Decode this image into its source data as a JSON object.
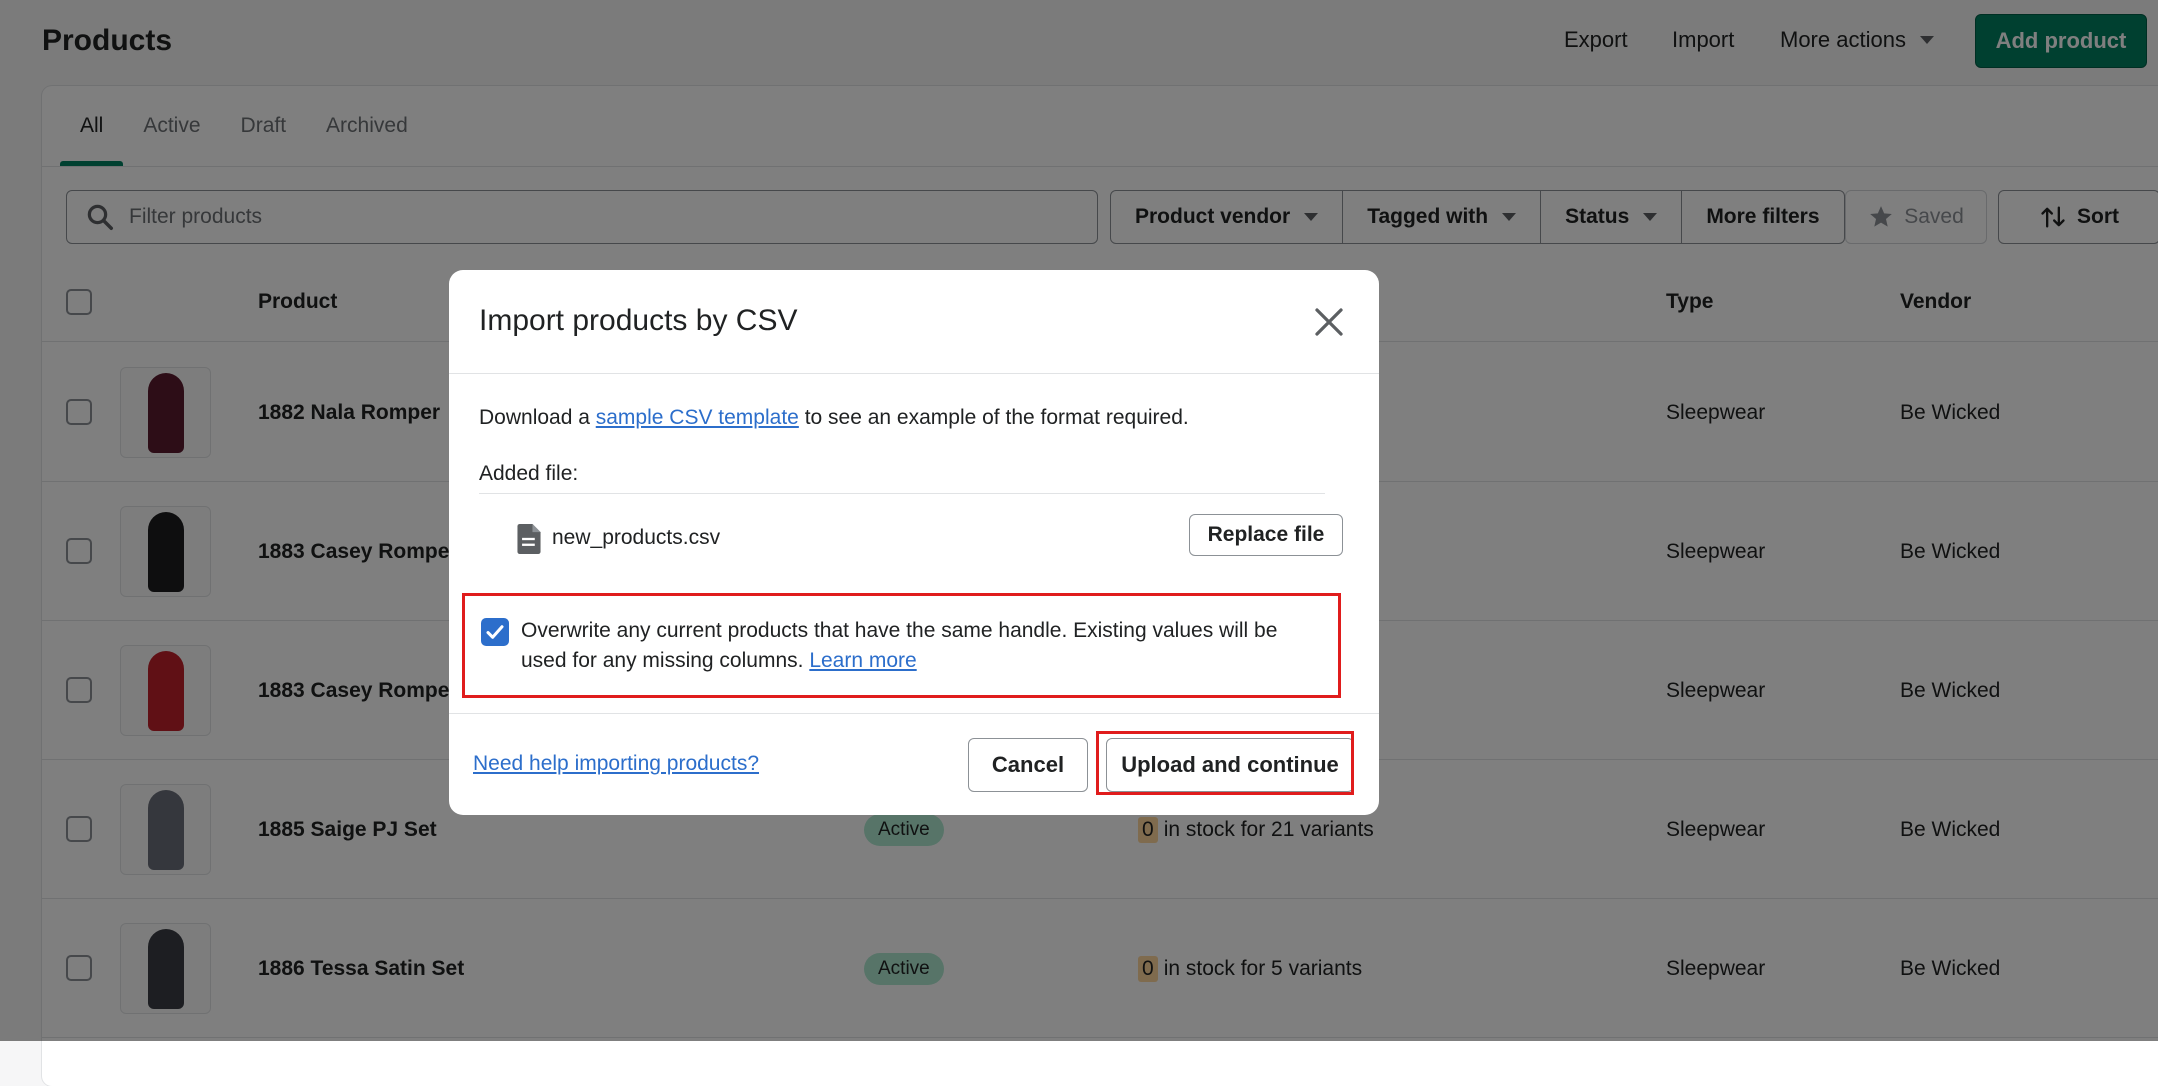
{
  "header": {
    "title": "Products",
    "export_label": "Export",
    "import_label": "Import",
    "more_actions_label": "More actions",
    "add_product_label": "Add product"
  },
  "tabs": [
    {
      "label": "All",
      "active": true
    },
    {
      "label": "Active",
      "active": false
    },
    {
      "label": "Draft",
      "active": false
    },
    {
      "label": "Archived",
      "active": false
    }
  ],
  "search": {
    "placeholder": "Filter products"
  },
  "filters": {
    "product_vendor": "Product vendor",
    "tagged_with": "Tagged with",
    "status": "Status",
    "more_filters": "More filters",
    "saved": "Saved",
    "sort": "Sort"
  },
  "table": {
    "headers": {
      "product": "Product",
      "type": "Type",
      "vendor": "Vendor"
    },
    "rows": [
      {
        "name": "1882 Nala Romper",
        "status": "",
        "inventory_zero": "",
        "inventory_text": "",
        "type": "Sleepwear",
        "vendor": "Be Wicked",
        "thumb_color": "#5a1a2e"
      },
      {
        "name": "1883 Casey Rompe",
        "status": "",
        "inventory_zero": "",
        "inventory_text": "",
        "type": "Sleepwear",
        "vendor": "Be Wicked",
        "thumb_color": "#1c1c1f"
      },
      {
        "name": "1883 Casey Rompe",
        "status": "",
        "inventory_zero": "",
        "inventory_text": "",
        "type": "Sleepwear",
        "vendor": "Be Wicked",
        "thumb_color": "#c0202a"
      },
      {
        "name": "1885 Saige PJ Set",
        "status": "Active",
        "inventory_zero": "0",
        "inventory_text": "in stock for 21 variants",
        "type": "Sleepwear",
        "vendor": "Be Wicked",
        "thumb_color": "#6b6f7a"
      },
      {
        "name": "1886 Tessa Satin Set",
        "status": "Active",
        "inventory_zero": "0",
        "inventory_text": "in stock for 5 variants",
        "type": "Sleepwear",
        "vendor": "Be Wicked",
        "thumb_color": "#3a3d44"
      }
    ]
  },
  "modal": {
    "title": "Import products by CSV",
    "desc_prefix": "Download a",
    "desc_link": "sample CSV template",
    "desc_suffix": "to see an example of the format required.",
    "added_file_label": "Added file:",
    "file_name": "new_products.csv",
    "replace_file_label": "Replace file",
    "overwrite_checked": true,
    "overwrite_text": "Overwrite any current products that have the same handle. Existing values will be used for any missing columns.",
    "learn_more": "Learn more",
    "help_link": "Need help importing products?",
    "cancel_label": "Cancel",
    "upload_label": "Upload and continue"
  },
  "colors": {
    "primary": "#008060",
    "link": "#2c6ecb",
    "highlight": "#e01c1c",
    "active_badge": "#aee9d1"
  }
}
